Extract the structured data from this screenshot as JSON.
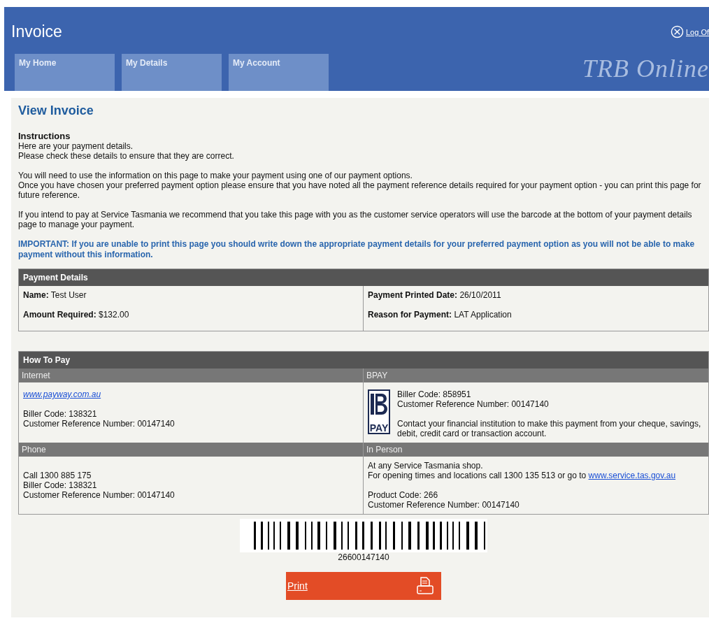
{
  "header": {
    "title": "Invoice",
    "logout": "Log Of",
    "brand": "TRB Online"
  },
  "nav": [
    {
      "label": "My Home",
      "selected": false
    },
    {
      "label": "My Details",
      "selected": false
    },
    {
      "label": "My Account",
      "selected": false
    }
  ],
  "heading": "View Invoice",
  "instructions": {
    "title": "Instructions",
    "paragraphs": [
      [
        "Here are your payment details.",
        "Please check these details to ensure that they are correct."
      ],
      [
        "You will need to use the information on this page to make your payment using one of our payment options.",
        "Once you have chosen your preferred payment option please ensure that you have noted all the payment reference details required for your payment option - you can print this page for future reference."
      ],
      [
        "If you intend to pay at Service Tasmania we recommend that you take this page with you as the customer service operators will use the barcode at the bottom of your payment details page to manage your payment."
      ]
    ],
    "important": "IMPORTANT: If you are unable to print this page you should write down the appropriate payment details for your preferred payment option as you will not be able to make payment without this information."
  },
  "payment_details": {
    "title": "Payment Details",
    "left": [
      {
        "label": "Name:",
        "value": "Test User"
      },
      {
        "label": "Amount Required:",
        "value": "$132.00"
      }
    ],
    "right": [
      {
        "label": "Payment Printed Date:",
        "value": "26/10/2011"
      },
      {
        "label": "Reason for Payment:",
        "value": "LAT Application"
      }
    ]
  },
  "how_to_pay": {
    "title": "How To Pay",
    "internet": {
      "heading": "Internet",
      "link": "www.payway.com.au",
      "lines": [
        "Biller Code: 138321",
        "Customer Reference Number: 00147140"
      ]
    },
    "bpay": {
      "heading": "BPAY",
      "logo_text": "PAY",
      "lines": [
        "Biller Code: 858951",
        "Customer Reference Number: 00147140"
      ],
      "note": "Contact your financial institution to make this payment from your cheque, savings, debit, credit card or transaction account."
    },
    "phone": {
      "heading": "Phone",
      "lines": [
        "Call 1300 885 175",
        "Biller Code: 138321",
        "Customer Reference Number: 00147140"
      ]
    },
    "in_person": {
      "heading": "In Person",
      "line": "At any Service Tasmania shop.",
      "link_prefix": "For opening times and locations call 1300 135 513 or go to",
      "link": "www.service.tas.gov.au",
      "lines": [
        "Product Code: 266",
        "Customer Reference Number: 00147140"
      ]
    }
  },
  "barcode": {
    "number": "26600147140"
  },
  "print_button": {
    "label": "Print"
  }
}
